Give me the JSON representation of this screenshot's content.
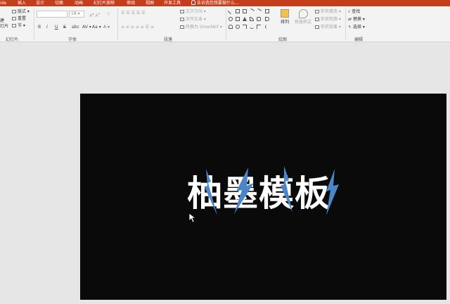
{
  "tabs": [
    "ide",
    "插入",
    "设计",
    "切换",
    "动画",
    "幻灯片放映",
    "审阅",
    "视图",
    "开发工具"
  ],
  "tell_me": "告诉我您想要做什么...",
  "ribbon": {
    "slides": {
      "new_slide_1": "建",
      "new_slide_2": "灯片",
      "layout": "版式",
      "reset": "重置",
      "section": "节",
      "label": "幻灯片"
    },
    "font": {
      "size": "18",
      "bold": "B",
      "italic": "I",
      "underline": "U",
      "strike": "S",
      "label": "字体"
    },
    "paragraph": {
      "text_dir": "文字方向",
      "align_text": "对齐文本",
      "smartart": "转换为 SmartArt",
      "label": "段落"
    },
    "drawing": {
      "arrange": "排列",
      "quick_styles": "快速样式",
      "fill": "形状填充",
      "outline": "形状轮廓",
      "effects": "形状效果",
      "label": "绘图"
    },
    "editing": {
      "find": "查找",
      "replace": "替换",
      "select": "选择",
      "label": "编辑"
    }
  },
  "slide": {
    "title": "柚墨模板"
  },
  "colors": {
    "accent": "#c43e1c",
    "bolt": "#4a86c8",
    "slide_bg": "#0a0a0a"
  }
}
